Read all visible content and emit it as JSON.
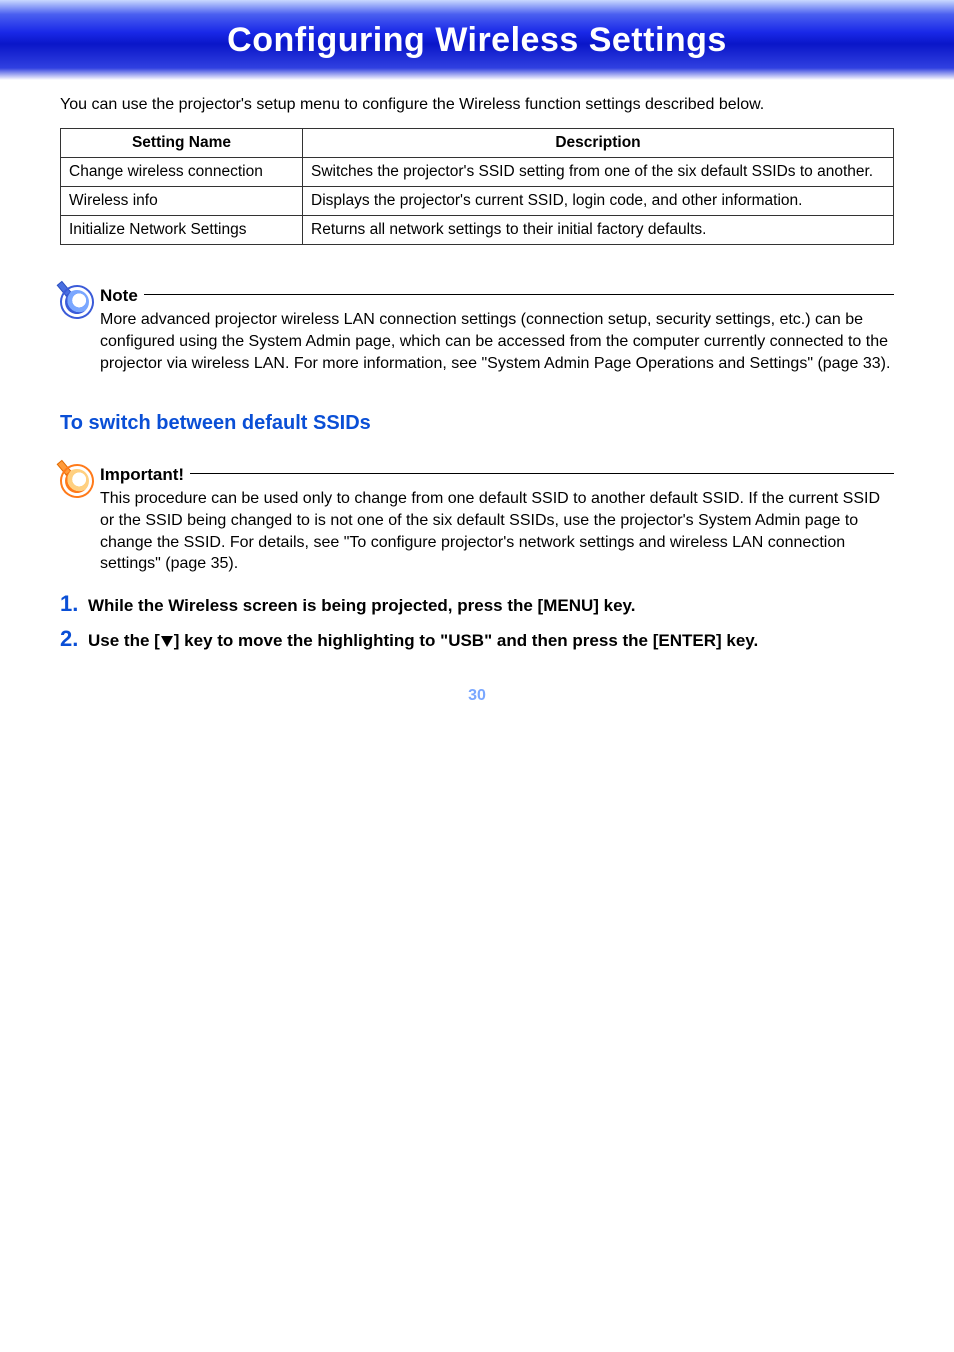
{
  "banner": {
    "title": "Configuring Wireless Settings"
  },
  "intro": "You can use the projector's setup menu to configure the Wireless function settings described below.",
  "table": {
    "headers": {
      "col1": "Setting Name",
      "col2": "Description"
    },
    "rows": [
      {
        "name": "Change wireless connection",
        "desc": "Switches the projector's SSID setting from one of the six default SSIDs to another."
      },
      {
        "name": "Wireless info",
        "desc": "Displays the projector's current SSID, login code, and other information."
      },
      {
        "name": "Initialize Network Settings",
        "desc": "Returns all network settings to their initial factory defaults."
      }
    ]
  },
  "note": {
    "label": "Note",
    "text": "More advanced projector wireless LAN connection settings (connection setup, security settings, etc.) can be configured using the System Admin page, which can be accessed from the computer currently connected to the projector via wireless LAN. For more information, see \"System Admin Page Operations and Settings\" (page 33)."
  },
  "section_heading": "To switch between default SSIDs",
  "important": {
    "label": "Important!",
    "text": "This procedure can be used only to change from one default SSID to another default SSID. If the current SSID or the SSID being changed to is not one of the six default SSIDs, use the projector's System Admin page to change the SSID. For details, see \"To configure projector's network settings and wireless LAN connection settings\" (page 35)."
  },
  "steps": [
    {
      "num": "1.",
      "text_full": "While the Wireless screen is being projected, press the [MENU] key."
    },
    {
      "num": "2.",
      "text_before": "Use the [",
      "text_after": "] key to move the highlighting to \"USB\" and then press the [ENTER] key."
    }
  ],
  "page_number": "30"
}
